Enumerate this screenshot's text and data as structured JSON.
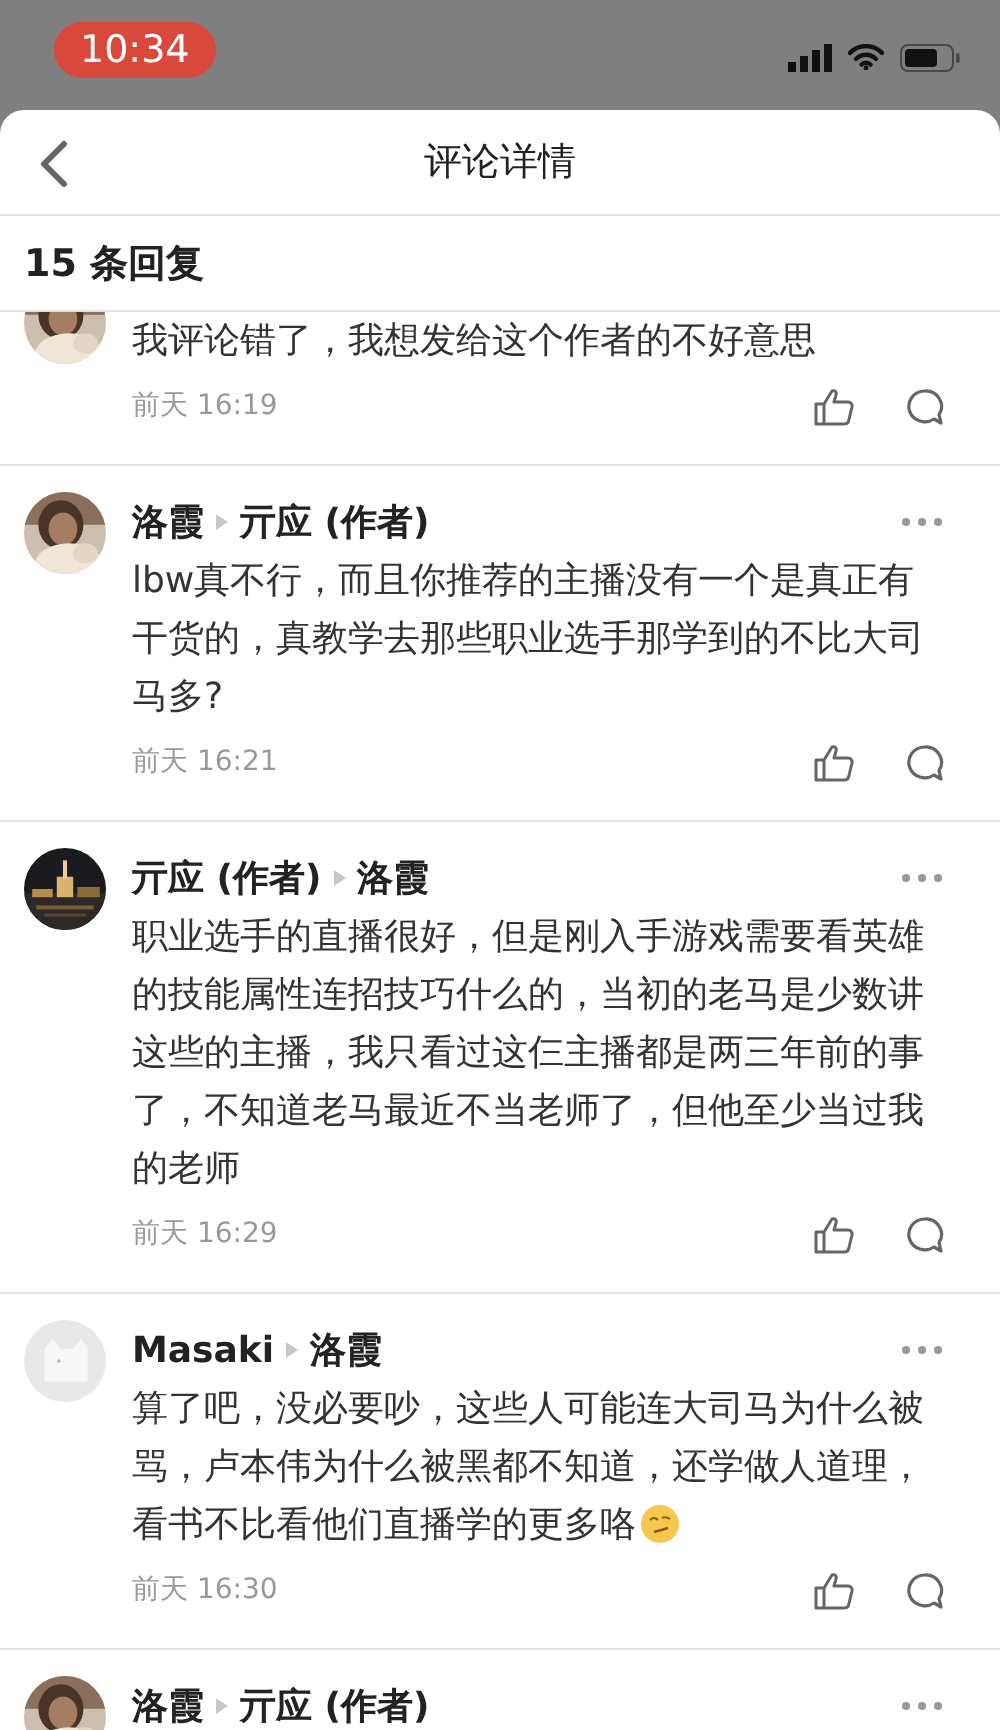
{
  "status_bar": {
    "time": "10:34"
  },
  "header": {
    "title": "评论详情"
  },
  "reply_count": "15 条回复",
  "comments": [
    {
      "default_avatar": false,
      "clipped": true,
      "body": "我评论错了，我想发给这个作者的不好意思",
      "time": "前天 16:19"
    },
    {
      "default_avatar": false,
      "clipped": false,
      "author": "洛霞",
      "reply_to": "亓应 (作者)",
      "body": "lbw真不行，而且你推荐的主播没有一个是真正有干货的，真教学去那些职业选手那学到的不比大司马多?",
      "time": "前天 16:21"
    },
    {
      "default_avatar": false,
      "clipped": false,
      "author": "亓应 (作者)",
      "reply_to": "洛霞",
      "body": "职业选手的直播很好，但是刚入手游戏需要看英雄的技能属性连招技巧什么的，当初的老马是少数讲这些的主播，我只看过这仨主播都是两三年前的事了，不知道老马最近不当老师了，但他至少当过我的老师",
      "time": "前天 16:29"
    },
    {
      "default_avatar": true,
      "clipped": false,
      "author": "Masaki",
      "reply_to": "洛霞",
      "body": "算了吧，没必要吵，这些人可能连大司马为什么被骂，卢本伟为什么被黑都不知道，还学做人道理，看书不比看他们直播学的更多咯",
      "emoji": true,
      "time": "前天 16:30"
    },
    {
      "default_avatar": false,
      "clipped": false,
      "author": "洛霞",
      "reply_to": "亓应 (作者)"
    }
  ]
}
